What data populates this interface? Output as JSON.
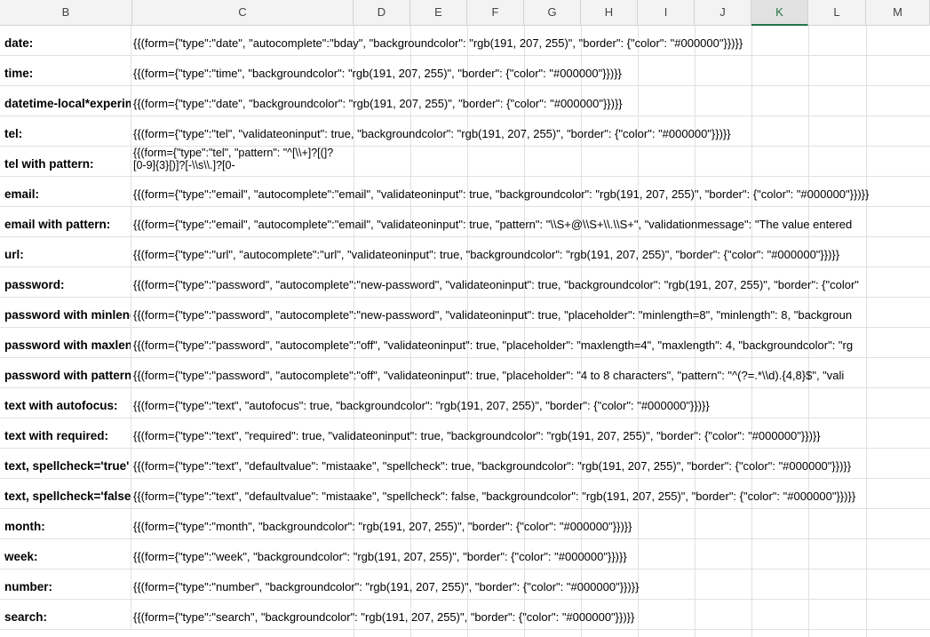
{
  "columns": [
    "B",
    "C",
    "D",
    "E",
    "F",
    "G",
    "H",
    "I",
    "J",
    "K",
    "L",
    "M"
  ],
  "selected_column": "K",
  "rows": [
    {
      "label": "date:",
      "value": "{{(form={\"type\":\"date\", \"autocomplete\":\"bday\", \"backgroundcolor\": \"rgb(191, 207, 255)\", \"border\": {\"color\": \"#000000\"}})}}"
    },
    {
      "label": "time:",
      "value": "{{(form={\"type\":\"time\", \"backgroundcolor\": \"rgb(191, 207, 255)\", \"border\": {\"color\": \"#000000\"}})}}"
    },
    {
      "label": "datetime-local*experimental",
      "value": "{{(form={\"type\":\"date\", \"backgroundcolor\": \"rgb(191, 207, 255)\", \"border\": {\"color\": \"#000000\"}})}}"
    },
    {
      "label": "tel:",
      "value": "{{(form={\"type\":\"tel\", \"validateoninput\": true, \"backgroundcolor\": \"rgb(191, 207, 255)\", \"border\": {\"color\": \"#000000\"}})}}"
    },
    {
      "label": "tel with pattern:",
      "value": "{{(form={\"type\":\"tel\", \"pattern\": \"^[\\\\+]?[(]?[0-9]{3}[)]?[-\\\\s\\\\.]?[0-",
      "wrap": true
    },
    {
      "label": "email:",
      "value": "{{(form={\"type\":\"email\", \"autocomplete\":\"email\", \"validateoninput\": true, \"backgroundcolor\": \"rgb(191, 207, 255)\", \"border\": {\"color\": \"#000000\"}})}}"
    },
    {
      "label": "email with pattern:",
      "value": "{{(form={\"type\":\"email\", \"autocomplete\":\"email\", \"validateoninput\": true, \"pattern\": \"\\\\S+@\\\\S+\\\\.\\\\S+\", \"validationmessage\": \"The value entered"
    },
    {
      "label": "url:",
      "value": "{{(form={\"type\":\"url\", \"autocomplete\":\"url\", \"validateoninput\": true, \"backgroundcolor\": \"rgb(191, 207, 255)\", \"border\": {\"color\": \"#000000\"}})}}"
    },
    {
      "label": "password:",
      "value": "{{(form={\"type\":\"password\", \"autocomplete\":\"new-password\", \"validateoninput\": true, \"backgroundcolor\": \"rgb(191, 207, 255)\", \"border\": {\"color\""
    },
    {
      "label": "password with minlength",
      "value": "{{(form={\"type\":\"password\", \"autocomplete\":\"new-password\", \"validateoninput\": true, \"placeholder\": \"minlength=8\", \"minlength\": 8, \"backgroun"
    },
    {
      "label": "password with maxlength",
      "value": "{{(form={\"type\":\"password\", \"autocomplete\":\"off\", \"validateoninput\": true, \"placeholder\": \"maxlength=4\", \"maxlength\": 4, \"backgroundcolor\": \"rg"
    },
    {
      "label": "password with pattern",
      "value": "{{(form={\"type\":\"password\", \"autocomplete\":\"off\", \"validateoninput\": true, \"placeholder\": \"4 to 8 characters\", \"pattern\": \"^(?=.*\\\\d).{4,8}$\",  \"vali"
    },
    {
      "label": "text with autofocus:",
      "value": "{{(form={\"type\":\"text\", \"autofocus\": true, \"backgroundcolor\": \"rgb(191, 207, 255)\", \"border\": {\"color\": \"#000000\"}})}}"
    },
    {
      "label": "text with required:",
      "value": "{{(form={\"type\":\"text\", \"required\": true, \"validateoninput\": true, \"backgroundcolor\": \"rgb(191, 207, 255)\", \"border\": {\"color\": \"#000000\"}})}}"
    },
    {
      "label": "text, spellcheck='true'",
      "value": "{{(form={\"type\":\"text\", \"defaultvalue\": \"mistaake\", \"spellcheck\": true, \"backgroundcolor\": \"rgb(191, 207, 255)\", \"border\": {\"color\": \"#000000\"}})}}"
    },
    {
      "label": "text, spellcheck='false'",
      "value": "{{(form={\"type\":\"text\", \"defaultvalue\": \"mistaake\", \"spellcheck\": false, \"backgroundcolor\": \"rgb(191, 207, 255)\", \"border\": {\"color\": \"#000000\"}})}}"
    },
    {
      "label": "month:",
      "value": "{{(form={\"type\":\"month\", \"backgroundcolor\": \"rgb(191, 207, 255)\", \"border\": {\"color\": \"#000000\"}})}}"
    },
    {
      "label": "week:",
      "value": "{{(form={\"type\":\"week\", \"backgroundcolor\": \"rgb(191, 207, 255)\", \"border\": {\"color\": \"#000000\"}})}}"
    },
    {
      "label": "number:",
      "value": "{{(form={\"type\":\"number\", \"backgroundcolor\": \"rgb(191, 207, 255)\", \"border\": {\"color\": \"#000000\"}})}}"
    },
    {
      "label": "search:",
      "value": "{{(form={\"type\":\"search\", \"backgroundcolor\": \"rgb(191, 207, 255)\", \"border\": {\"color\": \"#000000\"}})}}"
    }
  ]
}
